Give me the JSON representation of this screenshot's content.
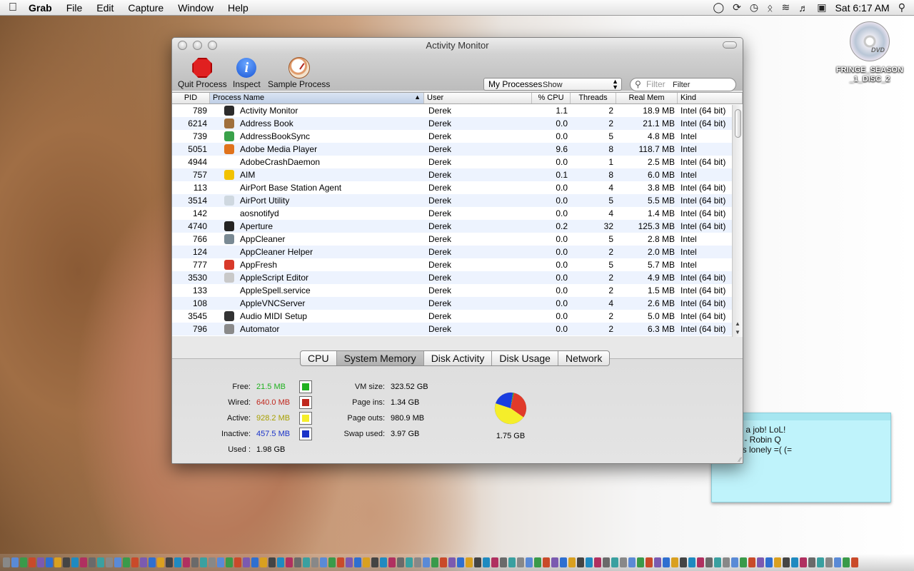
{
  "menubar": {
    "app_name": "Grab",
    "items": [
      "File",
      "Edit",
      "Capture",
      "Window",
      "Help"
    ],
    "clock": "Sat 6:17 AM"
  },
  "desktop": {
    "disc_label": "FRINGE_SEASON_1_DISC_2",
    "disc_badge": "DVD",
    "sticky_lines": [
      "for a job! LoL!",
      "ail - Robin Q",
      "ess lonely =(  (="
    ]
  },
  "window": {
    "title": "Activity Monitor",
    "toolbar": {
      "quit_label": "Quit Process",
      "inspect_label": "Inspect",
      "sample_label": "Sample Process",
      "show_value": "My Processes",
      "show_label": "Show",
      "filter_placeholder": "Filter",
      "filter_label": "Filter"
    },
    "columns": [
      "PID",
      "Process Name",
      "User",
      "% CPU",
      "Threads",
      "Real Mem",
      "Kind"
    ],
    "rows": [
      {
        "pid": "789",
        "name": "Activity Monitor",
        "user": "Derek",
        "cpu": "1.1",
        "threads": "2",
        "mem": "18.9 MB",
        "kind": "Intel (64 bit)",
        "icon": "activity-monitor-icon",
        "icon_color": "#2b2b2b"
      },
      {
        "pid": "6214",
        "name": "Address Book",
        "user": "Derek",
        "cpu": "0.0",
        "threads": "2",
        "mem": "21.1 MB",
        "kind": "Intel (64 bit)",
        "icon": "address-book-icon",
        "icon_color": "#a0703c"
      },
      {
        "pid": "739",
        "name": "AddressBookSync",
        "user": "Derek",
        "cpu": "0.0",
        "threads": "5",
        "mem": "4.8 MB",
        "kind": "Intel",
        "icon": "addressbooksync-icon",
        "icon_color": "#3aa24a"
      },
      {
        "pid": "5051",
        "name": "Adobe Media Player",
        "user": "Derek",
        "cpu": "9.6",
        "threads": "8",
        "mem": "118.7 MB",
        "kind": "Intel",
        "icon": "adobe-media-player-icon",
        "icon_color": "#e0731c"
      },
      {
        "pid": "4944",
        "name": "AdobeCrashDaemon",
        "user": "Derek",
        "cpu": "0.0",
        "threads": "1",
        "mem": "2.5 MB",
        "kind": "Intel (64 bit)",
        "icon": "",
        "icon_color": ""
      },
      {
        "pid": "757",
        "name": "AIM",
        "user": "Derek",
        "cpu": "0.1",
        "threads": "8",
        "mem": "6.0 MB",
        "kind": "Intel",
        "icon": "aim-running-man-icon",
        "icon_color": "#f2c200"
      },
      {
        "pid": "113",
        "name": "AirPort Base Station Agent",
        "user": "Derek",
        "cpu": "0.0",
        "threads": "4",
        "mem": "3.8 MB",
        "kind": "Intel (64 bit)",
        "icon": "",
        "icon_color": ""
      },
      {
        "pid": "3514",
        "name": "AirPort Utility",
        "user": "Derek",
        "cpu": "0.0",
        "threads": "5",
        "mem": "5.5 MB",
        "kind": "Intel (64 bit)",
        "icon": "airport-utility-icon",
        "icon_color": "#cfd8e0"
      },
      {
        "pid": "142",
        "name": "aosnotifyd",
        "user": "Derek",
        "cpu": "0.0",
        "threads": "4",
        "mem": "1.4 MB",
        "kind": "Intel (64 bit)",
        "icon": "",
        "icon_color": ""
      },
      {
        "pid": "4740",
        "name": "Aperture",
        "user": "Derek",
        "cpu": "0.2",
        "threads": "32",
        "mem": "125.3 MB",
        "kind": "Intel (64 bit)",
        "icon": "aperture-icon",
        "icon_color": "#222222"
      },
      {
        "pid": "766",
        "name": "AppCleaner",
        "user": "Derek",
        "cpu": "0.0",
        "threads": "5",
        "mem": "2.8 MB",
        "kind": "Intel",
        "icon": "appcleaner-trash-icon",
        "icon_color": "#7a8a94"
      },
      {
        "pid": "124",
        "name": "AppCleaner Helper",
        "user": "Derek",
        "cpu": "0.0",
        "threads": "2",
        "mem": "2.0 MB",
        "kind": "Intel",
        "icon": "",
        "icon_color": ""
      },
      {
        "pid": "777",
        "name": "AppFresh",
        "user": "Derek",
        "cpu": "0.0",
        "threads": "5",
        "mem": "5.7 MB",
        "kind": "Intel",
        "icon": "appfresh-icon",
        "icon_color": "#d83a2a"
      },
      {
        "pid": "3530",
        "name": "AppleScript Editor",
        "user": "Derek",
        "cpu": "0.0",
        "threads": "2",
        "mem": "4.9 MB",
        "kind": "Intel (64 bit)",
        "icon": "applescript-editor-icon",
        "icon_color": "#c9c9c9"
      },
      {
        "pid": "133",
        "name": "AppleSpell.service",
        "user": "Derek",
        "cpu": "0.0",
        "threads": "2",
        "mem": "1.5 MB",
        "kind": "Intel (64 bit)",
        "icon": "",
        "icon_color": ""
      },
      {
        "pid": "108",
        "name": "AppleVNCServer",
        "user": "Derek",
        "cpu": "0.0",
        "threads": "4",
        "mem": "2.6 MB",
        "kind": "Intel (64 bit)",
        "icon": "",
        "icon_color": ""
      },
      {
        "pid": "3545",
        "name": "Audio MIDI Setup",
        "user": "Derek",
        "cpu": "0.0",
        "threads": "2",
        "mem": "5.0 MB",
        "kind": "Intel (64 bit)",
        "icon": "audio-midi-setup-icon",
        "icon_color": "#333333"
      },
      {
        "pid": "796",
        "name": "Automator",
        "user": "Derek",
        "cpu": "0.0",
        "threads": "2",
        "mem": "6.3 MB",
        "kind": "Intel (64 bit)",
        "icon": "automator-robot-icon",
        "icon_color": "#8a8a8a"
      }
    ],
    "tabs": [
      "CPU",
      "System Memory",
      "Disk Activity",
      "Disk Usage",
      "Network"
    ],
    "active_tab": "System Memory",
    "memory": {
      "free_label": "Free:",
      "free": "21.5 MB",
      "free_color": "#1fb11f",
      "wired_label": "Wired:",
      "wired": "640.0 MB",
      "wired_color": "#c0281e",
      "active_label": "Active:",
      "active": "928.2 MB",
      "active_color": "#a8a000",
      "inactive_label": "Inactive:",
      "inactive": "457.5 MB",
      "inactive_color": "#1a33c8",
      "used_label": "Used :",
      "used": "1.98 GB",
      "vm_size_label": "VM size:",
      "vm_size": "323.52 GB",
      "page_ins_label": "Page ins:",
      "page_ins": "1.34 GB",
      "page_outs_label": "Page outs:",
      "page_outs": "980.9 MB",
      "swap_label": "Swap used:",
      "swap": "3.97 GB",
      "total": "1.75 GB"
    }
  }
}
